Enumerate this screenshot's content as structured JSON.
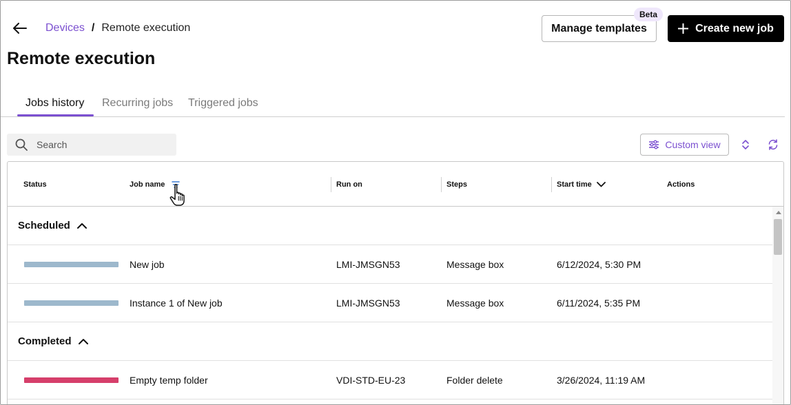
{
  "header": {
    "breadcrumb": {
      "parent": "Devices",
      "separator": "/",
      "current": "Remote execution"
    },
    "manage_templates_label": "Manage templates",
    "beta_label": "Beta",
    "create_job_label": "Create new job",
    "page_title": "Remote execution"
  },
  "tabs": [
    {
      "label": "Jobs history",
      "active": true
    },
    {
      "label": "Recurring jobs",
      "active": false
    },
    {
      "label": "Triggered jobs",
      "active": false
    }
  ],
  "toolbar": {
    "search_placeholder": "Search",
    "custom_view_label": "Custom view"
  },
  "table": {
    "columns": {
      "status": "Status",
      "job_name": "Job name",
      "run_on": "Run on",
      "steps": "Steps",
      "start_time": "Start time",
      "actions": "Actions"
    },
    "groups": [
      {
        "label": "Scheduled",
        "rows": [
          {
            "status_color": "#9db8cc",
            "job_name": "New job",
            "run_on": "LMI-JMSGN53",
            "steps": "Message box",
            "start_time": "6/12/2024, 5:30 PM"
          },
          {
            "status_color": "#9db8cc",
            "job_name": "Instance 1 of New job",
            "run_on": "LMI-JMSGN53",
            "steps": "Message box",
            "start_time": "6/11/2024, 5:35 PM"
          }
        ]
      },
      {
        "label": "Completed",
        "rows": [
          {
            "status_color": "#d63f6b",
            "job_name": "Empty temp folder",
            "run_on": "VDI-STD-EU-23",
            "steps": "Folder delete",
            "start_time": "3/26/2024, 11:19 AM"
          }
        ]
      }
    ]
  },
  "colors": {
    "accent": "#7b4fd0",
    "primary_button": "#000000",
    "status_scheduled": "#9db8cc",
    "status_completed": "#d63f6b"
  }
}
